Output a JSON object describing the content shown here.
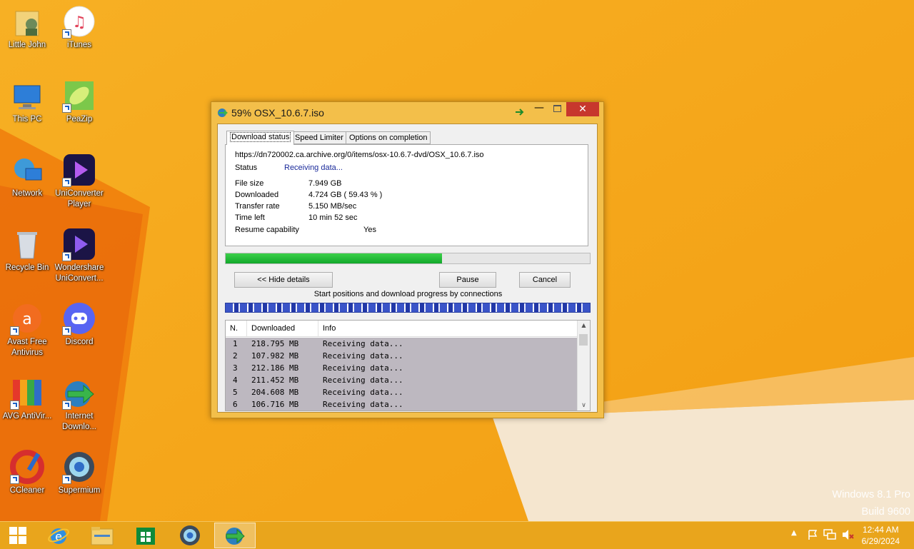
{
  "desktop": {
    "icons": [
      {
        "label": "Little John"
      },
      {
        "label": "iTunes"
      },
      {
        "label": "This PC"
      },
      {
        "label": "PeaZip"
      },
      {
        "label": "Network"
      },
      {
        "label": "UniConverter Player"
      },
      {
        "label": "Recycle Bin"
      },
      {
        "label": "Wondershare UniConvert..."
      },
      {
        "label": "Avast Free Antivirus"
      },
      {
        "label": "Discord"
      },
      {
        "label": "AVG AntiVir..."
      },
      {
        "label": "Internet Downlo..."
      },
      {
        "label": "CCleaner"
      },
      {
        "label": "Supermium"
      }
    ],
    "watermark": {
      "line1": "Windows 8.1 Pro",
      "line2": "Build 9600"
    }
  },
  "window": {
    "title": "59% OSX_10.6.7.iso",
    "tabs": [
      "Download status",
      "Speed Limiter",
      "Options on completion"
    ],
    "url": "https://dn720002.ca.archive.org/0/items/osx-10.6.7-dvd/OSX_10.6.7.iso",
    "status_label": "Status",
    "status_value": "Receiving data...",
    "file_size_label": "File size",
    "file_size_value": "7.949  GB",
    "downloaded_label": "Downloaded",
    "downloaded_value": "4.724  GB  ( 59.43 % )",
    "transfer_rate_label": "Transfer rate",
    "transfer_rate_value": "5.150  MB/sec",
    "time_left_label": "Time left",
    "time_left_value": "10 min 52 sec",
    "resume_label": "Resume capability",
    "resume_value": "Yes",
    "progress_fraction": 0.5943,
    "hide_details_label": "<< Hide details",
    "pause_label": "Pause",
    "cancel_label": "Cancel",
    "connections_caption": "Start positions and download progress by connections",
    "list_headers": [
      "N.",
      "Downloaded",
      "Info"
    ],
    "connections": [
      {
        "n": "1",
        "downloaded": "218.795  MB",
        "info": "Receiving data..."
      },
      {
        "n": "2",
        "downloaded": "107.982  MB",
        "info": "Receiving data..."
      },
      {
        "n": "3",
        "downloaded": "212.186  MB",
        "info": "Receiving data..."
      },
      {
        "n": "4",
        "downloaded": "211.452  MB",
        "info": "Receiving data..."
      },
      {
        "n": "5",
        "downloaded": "204.608  MB",
        "info": "Receiving data..."
      },
      {
        "n": "6",
        "downloaded": "106.716  MB",
        "info": "Receiving data..."
      }
    ]
  },
  "taskbar": {
    "time": "12:44 AM",
    "date": "6/29/2024"
  },
  "colors": {
    "wallpaper": "#f6a81c",
    "progress": "#16b12f",
    "close_button": "#c7372d"
  }
}
